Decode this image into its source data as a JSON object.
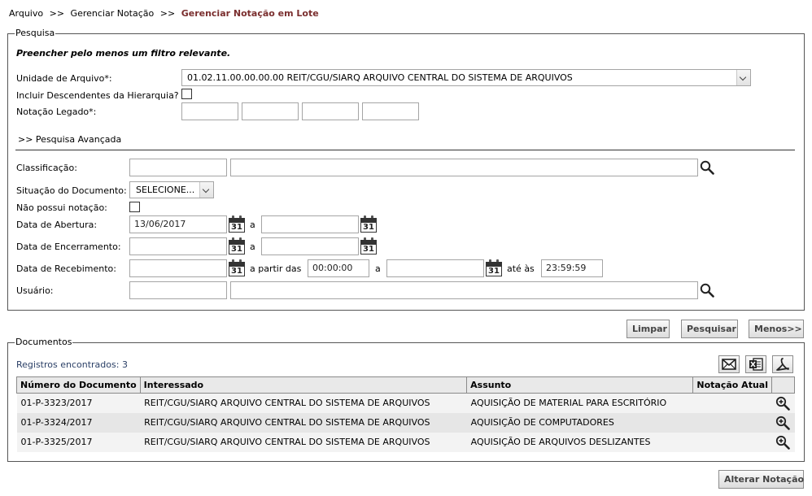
{
  "breadcrumb": {
    "item1": "Arquivo",
    "sep": ">>",
    "item2": "Gerenciar Notação",
    "current": "Gerenciar Notação em Lote"
  },
  "search": {
    "legend": "Pesquisa",
    "instruction": "Preencher pelo menos um filtro relevante.",
    "unidade_label": "Unidade de Arquivo*:",
    "unidade_value": "01.02.11.00.00.00.00 REIT/CGU/SIARQ ARQUIVO CENTRAL DO SISTEMA DE ARQUIVOS",
    "incluir_label": "Incluir Descendentes da Hierarquia?",
    "notacao_label": "Notação Legado*:",
    "advanced_link": ">>  Pesquisa Avançada",
    "classificacao_label": "Classificação:",
    "situacao_label": "Situação do Documento:",
    "situacao_value": "SELECIONE...",
    "nao_possui_label": "Não possui notação:",
    "abertura_label": "Data de Abertura:",
    "abertura_value": "13/06/2017",
    "encerramento_label": "Data de Encerramento:",
    "recebimento_label": "Data de Recebimento:",
    "a_label": "a",
    "a_partir_label": "a partir das",
    "ate_label": "até às",
    "hora_inicio": "00:00:00",
    "hora_fim": "23:59:59",
    "usuario_label": "Usuário:",
    "calendar_day": "31"
  },
  "actions": {
    "limpar": "Limpar",
    "pesquisar": "Pesquisar",
    "menos": "Menos>>"
  },
  "documents": {
    "legend": "Documentos",
    "count_text": "Registros encontrados: 3",
    "columns": [
      "Número do Documento",
      "Interessado",
      "Assunto",
      "Notação Atual"
    ],
    "rows": [
      {
        "numero": "01-P-3323/2017",
        "interessado": "REIT/CGU/SIARQ ARQUIVO CENTRAL DO SISTEMA DE ARQUIVOS",
        "assunto": "AQUISIÇÃO DE MATERIAL PARA ESCRITÓRIO",
        "notacao": ""
      },
      {
        "numero": "01-P-3324/2017",
        "interessado": "REIT/CGU/SIARQ ARQUIVO CENTRAL DO SISTEMA DE ARQUIVOS",
        "assunto": "AQUISIÇÃO DE COMPUTADORES",
        "notacao": ""
      },
      {
        "numero": "01-P-3325/2017",
        "interessado": "REIT/CGU/SIARQ ARQUIVO CENTRAL DO SISTEMA DE ARQUIVOS",
        "assunto": "AQUISIÇÃO DE ARQUIVOS DESLIZANTES",
        "notacao": ""
      }
    ],
    "export_icons": [
      "email-icon",
      "excel-icon",
      "pdf-icon"
    ]
  },
  "footer": {
    "alterar": "Alterar Notação"
  }
}
